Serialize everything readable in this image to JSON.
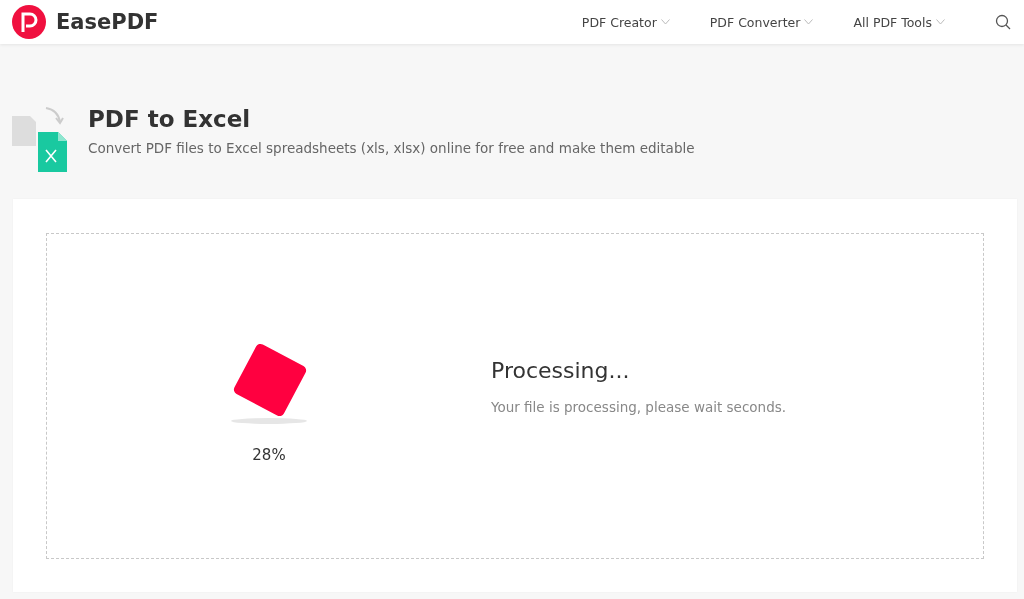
{
  "header": {
    "brand": "EasePDF",
    "nav": [
      {
        "label": "PDF Creator"
      },
      {
        "label": "PDF Converter"
      },
      {
        "label": "All PDF Tools"
      }
    ]
  },
  "tool": {
    "title": "PDF to Excel",
    "subtitle": "Convert PDF files to Excel spreadsheets (xls, xlsx) online for free and make them editable"
  },
  "progress": {
    "percent": "28%",
    "heading": "Processing...",
    "message": "Your file is processing, please wait seconds."
  }
}
